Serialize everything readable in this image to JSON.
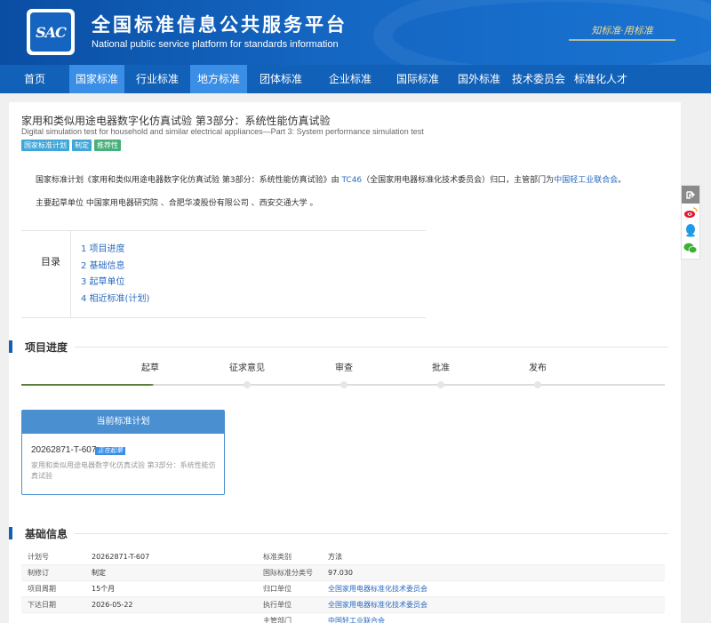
{
  "header": {
    "logo_text": "SAC",
    "title": "全国标准信息公共服务平台",
    "subtitle": "National public service platform  for standards information",
    "slogan": "知标准·用标准"
  },
  "nav": [
    {
      "label": "首页",
      "active": false
    },
    {
      "label": "国家标准",
      "active": true
    },
    {
      "label": "行业标准",
      "active": false
    },
    {
      "label": "地方标准",
      "active": true
    },
    {
      "label": "团体标准",
      "active": false
    },
    {
      "label": "企业标准",
      "active": false
    },
    {
      "label": "国际标准",
      "active": false
    },
    {
      "label": "国外标准",
      "active": false
    },
    {
      "label": "技术委员会",
      "active": false
    },
    {
      "label": "标准化人才",
      "active": false
    }
  ],
  "doc": {
    "title": "家用和类似用途电器数字化仿真试验 第3部分：系统性能仿真试验",
    "title_en": "Digital simulation test for household and similar electrical appliances—Part 3: System performance simulation test",
    "tags": [
      "国家标准计划",
      "制定",
      "推荐性"
    ]
  },
  "intro": {
    "prefix": "国家标准计划《家用和类似用途电器数字化仿真试验 第3部分：系统性能仿真试验》由 ",
    "tc_link": "TC46",
    "middle": "（全国家用电器标准化技术委员会）归口，主管部门为",
    "dept_link": "中国轻工业联合会",
    "suffix": "。",
    "drafters": "主要起草单位 中国家用电器研究院 、合肥华凌股份有限公司 、西安交通大学 。"
  },
  "toc": {
    "label": "目录",
    "items": [
      "1  项目进度",
      "2  基础信息",
      "3  起草单位",
      "4  相近标准(计划)"
    ]
  },
  "sections": {
    "progress": "项目进度",
    "basic": "基础信息"
  },
  "progress": {
    "steps": [
      "起草",
      "征求意见",
      "审查",
      "批准",
      "发布"
    ],
    "current_index": 0
  },
  "plan_card": {
    "header": "当前标准计划",
    "code": "20262871-T-607",
    "badge": "正在起草",
    "desc": "家用和类似用途电器数字化仿真试验 第3部分：系统性能仿真试验"
  },
  "basic_info": [
    {
      "k1": "计划号",
      "v1": "20262871-T-607",
      "k2": "标准类别",
      "v2": "方法",
      "v2_link": false
    },
    {
      "k1": "制修订",
      "v1": "制定",
      "k2": "国际标准分类号",
      "v2": "97.030",
      "v2_link": false
    },
    {
      "k1": "项目周期",
      "v1": "15个月",
      "k2": "归口单位",
      "v2": "全国家用电器标准化技术委员会",
      "v2_link": true
    },
    {
      "k1": "下达日期",
      "v1": "2026-05-22",
      "k2": "执行单位",
      "v2": "全国家用电器标准化技术委员会",
      "v2_link": true
    },
    {
      "k1": "",
      "v1": "",
      "k2": "主管部门",
      "v2": "中国轻工业联合会",
      "v2_link": true
    }
  ],
  "icons": {
    "share": "share-icon",
    "weibo": "weibo-icon",
    "qq": "qq-icon",
    "wechat": "wechat-icon"
  },
  "colors": {
    "header": "#0a4ea3",
    "nav": "#1261b8",
    "nav_active": "#3a8ee6",
    "link": "#2a6bbf",
    "progress_done": "#5b7f3a"
  }
}
